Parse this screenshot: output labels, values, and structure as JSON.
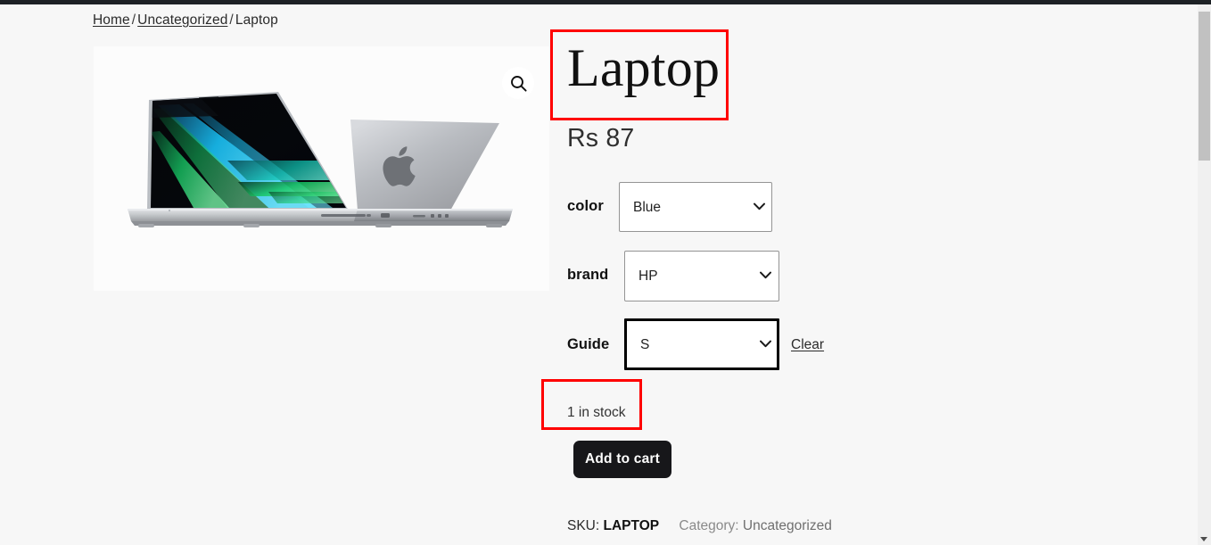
{
  "browser": {
    "scrollbar": {
      "position": "right",
      "thumb_visible": true,
      "down_arrow_icon": "triangle-down-icon"
    }
  },
  "breadcrumb": {
    "home": "Home",
    "category": "Uncategorized",
    "current": "Laptop",
    "separator": "/"
  },
  "gallery": {
    "zoom_icon": "magnifier-icon",
    "alt": "Two MacBook Pro laptops, one open showing blue and green abstract wallpaper, one closed showing Apple logo"
  },
  "product": {
    "title": "Laptop",
    "price": "Rs 87",
    "stock_status": "1 in stock",
    "add_to_cart_label": "Add to cart"
  },
  "variations": {
    "color": {
      "label": "color",
      "selected": "Blue",
      "options": [
        "Blue"
      ],
      "caret_icon": "chevron-down-icon"
    },
    "brand": {
      "label": "brand",
      "selected": "HP",
      "options": [
        "HP"
      ],
      "caret_icon": "chevron-down-icon"
    },
    "guide": {
      "label": "Guide",
      "selected": "S",
      "options": [
        "S"
      ],
      "caret_icon": "chevron-down-icon",
      "focused": true
    },
    "clear_label": "Clear"
  },
  "meta": {
    "sku_label": "SKU:",
    "sku_value": "LAPTOP",
    "category_label": "Category:",
    "category_value": "Uncategorized"
  },
  "annotations": {
    "title_highlight_color": "#ff0000",
    "stock_highlight_color": "#ff0000"
  },
  "colors": {
    "page_background": "#f7f7f7",
    "gallery_background": "#fcfcfc",
    "button_background": "#17171a",
    "top_bar": "#1d2125"
  }
}
